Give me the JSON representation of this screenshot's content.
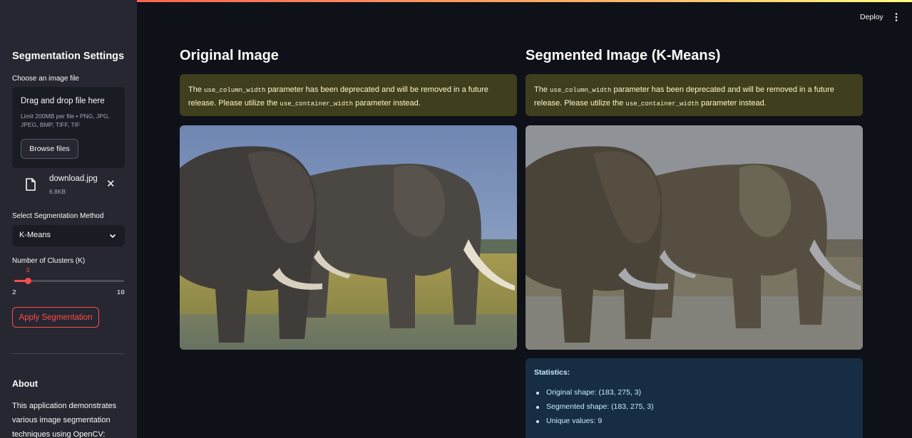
{
  "sidebar": {
    "title": "Segmentation Settings",
    "uploader_label": "Choose an image file",
    "dropzone_title": "Drag and drop file here",
    "dropzone_limit": "Limit 200MB per file • PNG, JPG, JPEG, BMP, TIFF, TIF",
    "browse_label": "Browse files",
    "file": {
      "name": "download.jpg",
      "size": "6.8KB"
    },
    "method_label": "Select Segmentation Method",
    "method_value": "K-Means",
    "clusters_label": "Number of Clusters (K)",
    "clusters": {
      "value": "3",
      "min": "2",
      "max": "10",
      "fraction": 0.125
    },
    "apply_label": "Apply Segmentation",
    "about_title": "About",
    "about_text": "This application demonstrates various image segmentation techniques using OpenCV:"
  },
  "header": {
    "deploy_label": "Deploy"
  },
  "main": {
    "original_title": "Original Image",
    "segmented_title": "Segmented Image (K-Means)",
    "warning": {
      "text_pre": "The ",
      "code_1": "use_column_width",
      "text_mid": " parameter has been deprecated and will be removed in a future release. Please utilize the ",
      "code_2": "use_container_width",
      "text_post": " parameter instead."
    },
    "stats": {
      "title": "Statistics:",
      "items": [
        "Original shape: (183, 275, 3)",
        "Segmented shape: (183, 275, 3)",
        "Unique values: 9"
      ]
    }
  },
  "colors": {
    "accent": "#ff4b4b",
    "warning_bg": "#3f3e1d",
    "info_bg": "#172d43"
  }
}
